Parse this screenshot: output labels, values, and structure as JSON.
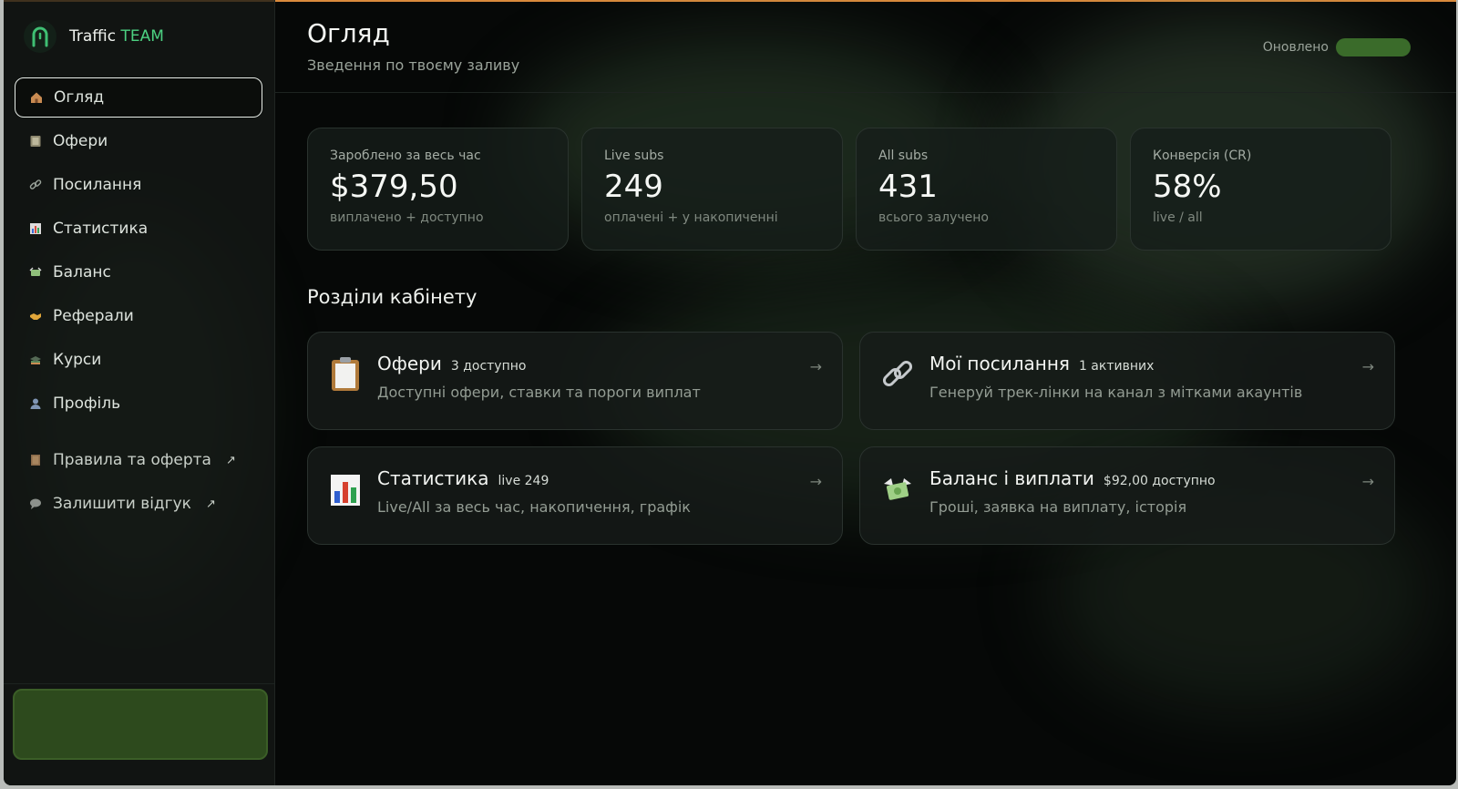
{
  "brand": {
    "name_part1": "Traffic",
    "name_part2": "TEAM"
  },
  "sidebar": {
    "items": [
      {
        "label": "Огляд",
        "icon": "home-icon",
        "active": true
      },
      {
        "label": "Офери",
        "icon": "notebook-icon"
      },
      {
        "label": "Посилання",
        "icon": "link-icon"
      },
      {
        "label": "Статистика",
        "icon": "chart-icon"
      },
      {
        "label": "Баланс",
        "icon": "money-icon"
      },
      {
        "label": "Реферали",
        "icon": "handshake-icon"
      },
      {
        "label": "Курси",
        "icon": "graduation-cap-icon"
      },
      {
        "label": "Профіль",
        "icon": "user-icon"
      }
    ],
    "links": [
      {
        "label": "Правила та оферта",
        "icon": "book-icon",
        "arrow": "↗"
      },
      {
        "label": "Залишити відгук",
        "icon": "speech-bubble-icon",
        "arrow": "↗"
      }
    ]
  },
  "header": {
    "title": "Огляд",
    "subtitle": "Зведення по твоєму заливу",
    "updated_label": "Оновлено"
  },
  "stats": [
    {
      "label": "Зароблено за весь час",
      "value": "$379,50",
      "hint": "виплачено + доступно"
    },
    {
      "label": "Live subs",
      "value": "249",
      "hint": "оплачені + у накопиченні"
    },
    {
      "label": "All subs",
      "value": "431",
      "hint": "всього залучено"
    },
    {
      "label": "Конверсія (CR)",
      "value": "58%",
      "hint": "live / all"
    }
  ],
  "sections_title": "Розділи кабінету",
  "cards": [
    {
      "title": "Офери",
      "badge": "3 доступно",
      "desc": "Доступні офери, ставки та пороги виплат",
      "icon": "clipboard-icon",
      "arrow": "→"
    },
    {
      "title": "Мої посилання",
      "badge": "1 активних",
      "desc": "Генеруй трек-лінки на канал з мітками акаунтів",
      "icon": "link-icon",
      "arrow": "→"
    },
    {
      "title": "Статистика",
      "badge": "live 249",
      "desc": "Live/All за весь час, накопичення, графік",
      "icon": "bar-chart-icon",
      "arrow": "→"
    },
    {
      "title": "Баланс і виплати",
      "badge": "$92,00 доступно",
      "desc": "Гроші, заявка на виплату, історія",
      "icon": "money-wings-icon",
      "arrow": "→"
    }
  ],
  "colors": {
    "accent": "#4cd081",
    "top_line": "#d98a3c",
    "updated_pill": "#3a6b2a",
    "sidebar_box": "#2d4a1d"
  }
}
